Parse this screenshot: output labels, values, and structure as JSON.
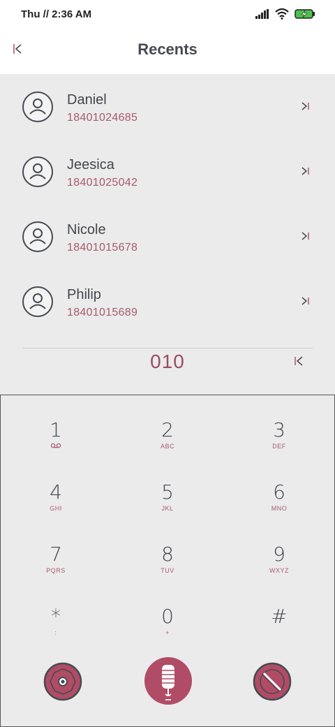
{
  "status": {
    "time": "Thu // 2:36 AM"
  },
  "header": {
    "title": "Recents"
  },
  "contacts": [
    {
      "name": "Daniel",
      "number": "18401024685"
    },
    {
      "name": "Jeesica",
      "number": "18401025042"
    },
    {
      "name": "Nicole",
      "number": "18401015678"
    },
    {
      "name": "Philip",
      "number": "18401015689"
    }
  ],
  "dialer": {
    "input": "010"
  },
  "keypad": [
    {
      "digit": "1",
      "letters": ""
    },
    {
      "digit": "2",
      "letters": "ABC"
    },
    {
      "digit": "3",
      "letters": "DEF"
    },
    {
      "digit": "4",
      "letters": "GHI"
    },
    {
      "digit": "5",
      "letters": "JKL"
    },
    {
      "digit": "6",
      "letters": "MNO"
    },
    {
      "digit": "7",
      "letters": "PQRS"
    },
    {
      "digit": "8",
      "letters": "TUV"
    },
    {
      "digit": "9",
      "letters": "WXYZ"
    },
    {
      "digit": "*",
      "letters": ":"
    },
    {
      "digit": "0",
      "letters": "+"
    },
    {
      "digit": "#",
      "letters": ""
    }
  ],
  "colors": {
    "accent": "#a85a6d",
    "button_fill": "#b04c66",
    "dark": "#464951"
  },
  "icons": {
    "back": "back-icon",
    "call": "call-icon",
    "voicemail": "voicemail-icon",
    "record": "record-icon",
    "mic": "microphone-icon",
    "mute": "mute-icon"
  }
}
